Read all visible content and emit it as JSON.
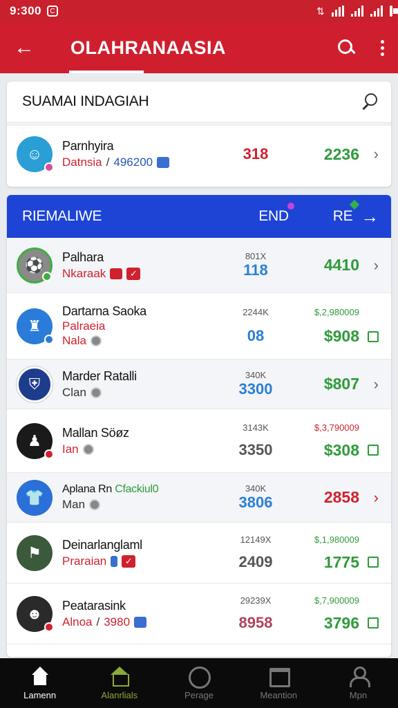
{
  "status": {
    "time": "9:300",
    "sim": "C"
  },
  "appbar": {
    "title": "OLAHRANAASIA"
  },
  "search_card": {
    "title": "SUAMAI INDAGIAH",
    "featured": {
      "name": "Parnhyira",
      "sub1": "Datnsia",
      "sep": "/",
      "sub2": "496200",
      "value_mid": "318",
      "value_right": "2236"
    }
  },
  "list": {
    "header": {
      "left": "RIEMALIWE",
      "mid": "END",
      "right": "RE"
    },
    "rows": [
      {
        "name": "Palhara",
        "sub": "Nkaraak",
        "small_mid": "801X",
        "mid": "118",
        "small_right": "",
        "right": "4410",
        "mid_color": "#2a7fd4",
        "right_color": "#2e9b3a",
        "avatar": "#8a8a8a",
        "icon": "flag-red"
      },
      {
        "name": "Dartarna Saoka",
        "sub_top": "Palraeia",
        "sub": "Nala",
        "small_mid": "2244K",
        "mid": "08",
        "small_right": "$,2,980009",
        "right": "$908",
        "mid_color": "#2a7fd4",
        "right_color": "#2e9b3a",
        "avatar": "#2b7bd8"
      },
      {
        "name": "Marder Ratalli",
        "sub": "Clan",
        "small_mid": "340K",
        "mid": "3300",
        "small_right": "",
        "right": "$807",
        "mid_color": "#2a7fd4",
        "right_color": "#2e9b3a",
        "avatar": "#1d3d8c"
      },
      {
        "name": "Mallan Söøz",
        "sub": "Ian",
        "small_mid": "3143K",
        "mid": "3350",
        "small_right": "$,3,790009",
        "right": "$308",
        "mid_color": "#555555",
        "right_color": "#2e9b3a",
        "avatar": "#1a1a1a"
      },
      {
        "name": "Aplana Rn",
        "name_extra": "Cfackiul0",
        "sub": "Man",
        "small_mid": "340K",
        "mid": "3806",
        "small_right": "",
        "right": "2858",
        "mid_color": "#2a7fd4",
        "right_color": "#d0212e",
        "avatar": "#2b6fd8"
      },
      {
        "name": "Deinarlanglaml",
        "sub": "Praraian",
        "small_mid": "12149X",
        "mid": "2409",
        "small_right": "$,1,980009",
        "right": "1775",
        "mid_color": "#555555",
        "right_color": "#2e9b3a",
        "avatar": "#3b5a3c"
      },
      {
        "name": "Peatarasink",
        "sub": "Alnoa",
        "sep": "/",
        "sub2": "3980",
        "small_mid": "29239X",
        "mid": "8958",
        "small_right": "$,7,900009",
        "right": "3796",
        "mid_color": "#b0425e",
        "right_color": "#2e9b3a",
        "avatar": "#2a2a2a"
      }
    ]
  },
  "nav": [
    {
      "label": "Lamenn",
      "icon": "home-icon"
    },
    {
      "label": "Alanrlials",
      "icon": "house-icon"
    },
    {
      "label": "Perage",
      "icon": "face-icon"
    },
    {
      "label": "Meantion",
      "icon": "menu-icon"
    },
    {
      "label": "Mpn",
      "icon": "user-icon"
    }
  ]
}
